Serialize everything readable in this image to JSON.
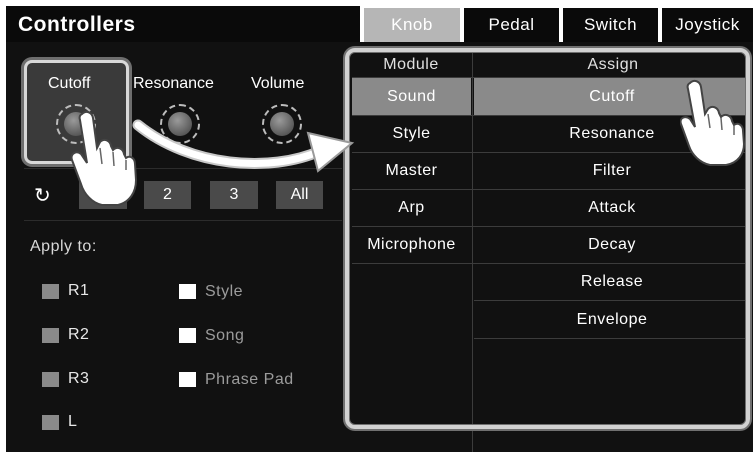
{
  "header": {
    "title": "Controllers"
  },
  "tabs": [
    {
      "label": "Knob",
      "active": true
    },
    {
      "label": "Pedal",
      "active": false
    },
    {
      "label": "Switch",
      "active": false
    },
    {
      "label": "Joystick",
      "active": false
    }
  ],
  "knobs": [
    {
      "label": "Cutoff",
      "selected": true
    },
    {
      "label": "Resonance",
      "selected": false
    },
    {
      "label": "Volume",
      "selected": false
    }
  ],
  "groups": {
    "reset_icon": "refresh-icon",
    "buttons": [
      "",
      "2",
      "3",
      "All"
    ]
  },
  "apply": {
    "label": "Apply to:",
    "parts": [
      {
        "label": "R1",
        "checked": false
      },
      {
        "label": "R2",
        "checked": false
      },
      {
        "label": "R3",
        "checked": false
      },
      {
        "label": "L",
        "checked": false
      }
    ],
    "sources": [
      {
        "label": "Style",
        "checked": true
      },
      {
        "label": "Song",
        "checked": true
      },
      {
        "label": "Phrase Pad",
        "checked": true
      }
    ]
  },
  "table": {
    "module_header": "Module",
    "assign_header": "Assign",
    "modules": [
      "Sound",
      "Style",
      "Master",
      "Arp",
      "Microphone"
    ],
    "selected_module": "Sound",
    "assigns": [
      "Cutoff",
      "Resonance",
      "Filter",
      "Attack",
      "Decay",
      "Release",
      "Envelope"
    ],
    "selected_assign": "Cutoff"
  },
  "colors": {
    "panel": "#111111",
    "tab_active": "#b6b6b6",
    "selection": "#8a8a8a",
    "highlight": "#d2d2d2"
  }
}
